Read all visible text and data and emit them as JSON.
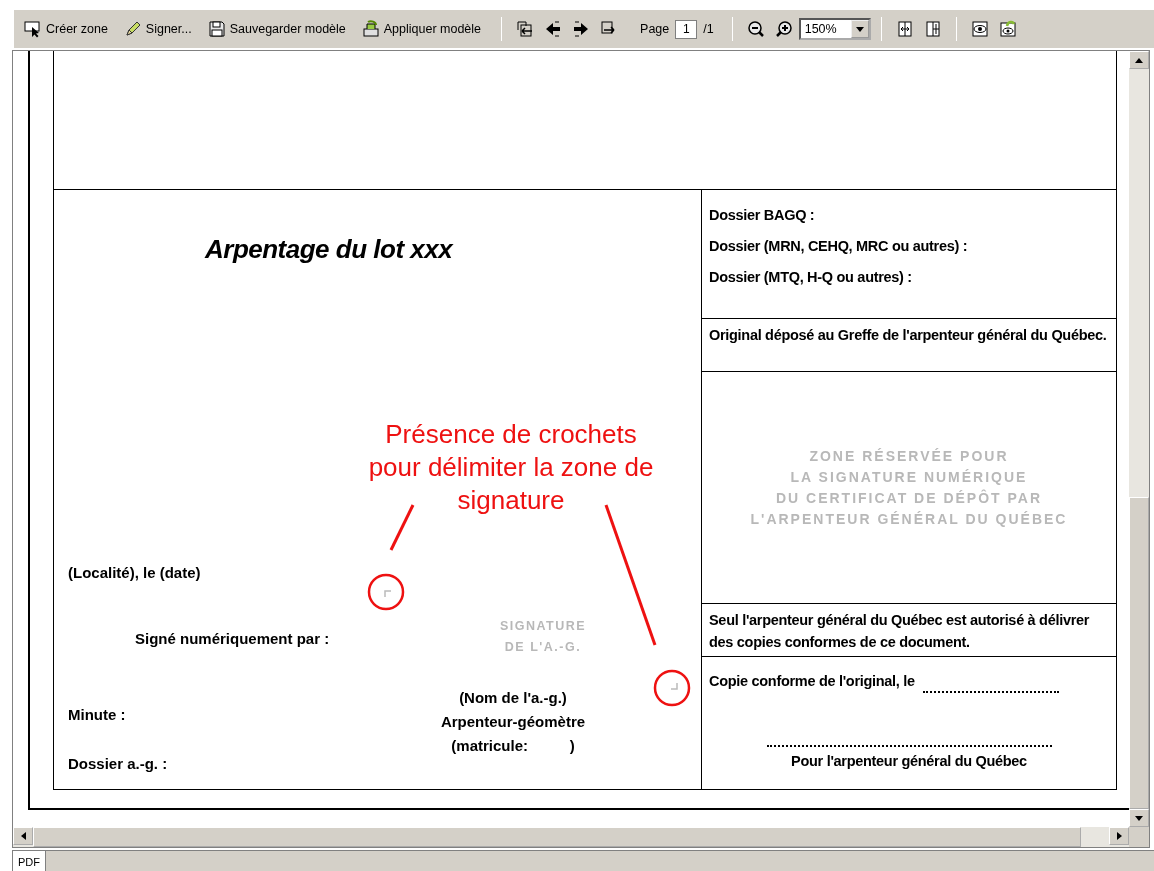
{
  "toolbar": {
    "buttons": [
      {
        "label": "Créer zone"
      },
      {
        "label": "Signer..."
      },
      {
        "label": "Sauvegarder modèle"
      },
      {
        "label": "Appliquer modèle"
      }
    ],
    "page": {
      "label": "Page",
      "value": "1",
      "total": "/1"
    },
    "zoom": {
      "value": "150%"
    }
  },
  "document": {
    "title": "Arpentage du lot xxx",
    "place_date": "(Localité), le (date)",
    "signed_by": "Signé numériquement par :",
    "signature_stamp": [
      "SIGNATURE",
      "DE L'A.-G."
    ],
    "surveyor": [
      "(Nom de l'a.-g.)",
      "Arpenteur-géomètre",
      "(matricule:          )"
    ],
    "minute": "Minute :",
    "file": "Dossier a.-g. :",
    "files": [
      "Dossier BAGQ :",
      "Dossier (MRN, CEHQ, MRC ou autres) :",
      "Dossier (MTQ, H-Q ou autres) :"
    ],
    "deposit": "Original déposé au Greffe de l'arpenteur général du Québec.",
    "reserved_zone": [
      "ZONE RÉSERVÉE POUR",
      "LA SIGNATURE NUMÉRIQUE",
      "DU CERTIFICAT DE DÉPÔT PAR",
      "L'ARPENTEUR GÉNÉRAL DU QUÉBEC"
    ],
    "copies_notice": "Seul l'arpenteur général du Québec est autorisé à délivrer des copies conformes de ce document.",
    "true_copy": "Copie conforme de l'original, le",
    "for_surveyor": "Pour l'arpenteur général du Québec"
  },
  "annotation": {
    "lines": [
      "Présence de crochets",
      "pour délimiter la zone de",
      "signature"
    ]
  },
  "status_bar": {
    "tabs": [
      {
        "label": "PDF",
        "selected": true
      }
    ]
  }
}
